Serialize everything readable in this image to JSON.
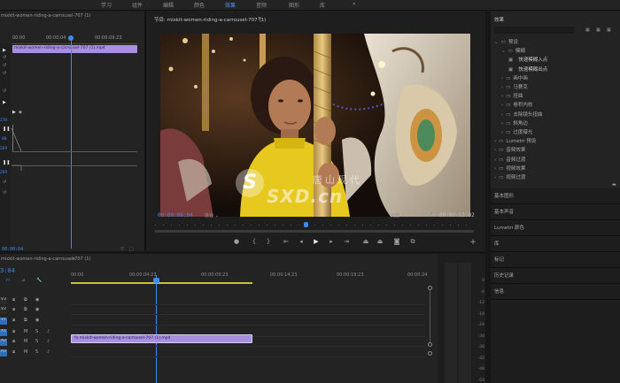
{
  "workspaces": [
    "学习",
    "组件",
    "编辑",
    "颜色",
    "效果",
    "音频",
    "图形",
    "库"
  ],
  "active_workspace": "效果",
  "effect_controls": {
    "timecodes": [
      "00:00",
      "00:00:04",
      "00:00:09:23"
    ],
    "clip_name": "mixkit-women-riding-a-carrousel-707 (1).mp4",
    "left_values": [
      "270",
      "00",
      "269",
      "269"
    ],
    "bottom_timecode": "00:00:04"
  },
  "program_monitor": {
    "title": "节目: mixkit-women-riding-a-carrousel-707 (1)",
    "current_tc": "00:00:06:04",
    "fit": "适合",
    "quality": "完整",
    "duration_tc": "00:00:13:02",
    "watermark_line1": "唐山现代",
    "watermark_line2": "SXD.cn",
    "watermark_logo": "S"
  },
  "timeline": {
    "sequence_title": "mixkit-women-riding-a-carrousel-707 (1)",
    "playhead_tc": "3:04",
    "ruler": [
      "00:00",
      "00:00:04:23",
      "00:00:09:23",
      "00:00:14:23",
      "00:00:19:23",
      "00:00:24"
    ],
    "clip_label": "mixkit-women-riding-a-carrousel-707 (1).mp4",
    "tracks": [
      "V3",
      "V2",
      "V1",
      "A1",
      "A2",
      "A3"
    ],
    "meter_labels": [
      "0",
      "-6",
      "-12",
      "-18",
      "-24",
      "-30",
      "-36",
      "-42",
      "-48",
      "-54"
    ]
  },
  "effects_panel": {
    "title": "效果",
    "tree": [
      {
        "label": "预设",
        "indent": 0
      },
      {
        "label": "模糊",
        "indent": 1
      },
      {
        "label": "快速模糊入点",
        "indent": 2
      },
      {
        "label": "快速模糊出点",
        "indent": 2
      },
      {
        "label": "画中画",
        "indent": 1
      },
      {
        "label": "马赛克",
        "indent": 1
      },
      {
        "label": "扭曲",
        "indent": 1
      },
      {
        "label": "卷积内核",
        "indent": 1
      },
      {
        "label": "去除镜头扭曲",
        "indent": 1
      },
      {
        "label": "斜角边",
        "indent": 1
      },
      {
        "label": "过度曝光",
        "indent": 1
      },
      {
        "label": "Lumetri 预设",
        "indent": 0
      },
      {
        "label": "音频效果",
        "indent": 0
      },
      {
        "label": "音频过渡",
        "indent": 0
      },
      {
        "label": "视频效果",
        "indent": 0
      },
      {
        "label": "视频过渡",
        "indent": 0
      }
    ],
    "bottom_panels": [
      "基本图形",
      "基本声音",
      "Lumetri 颜色",
      "库",
      "标记",
      "历史记录",
      "信息"
    ]
  },
  "colors": {
    "accent": "#3a8cf0",
    "clip": "#a88fe0"
  }
}
